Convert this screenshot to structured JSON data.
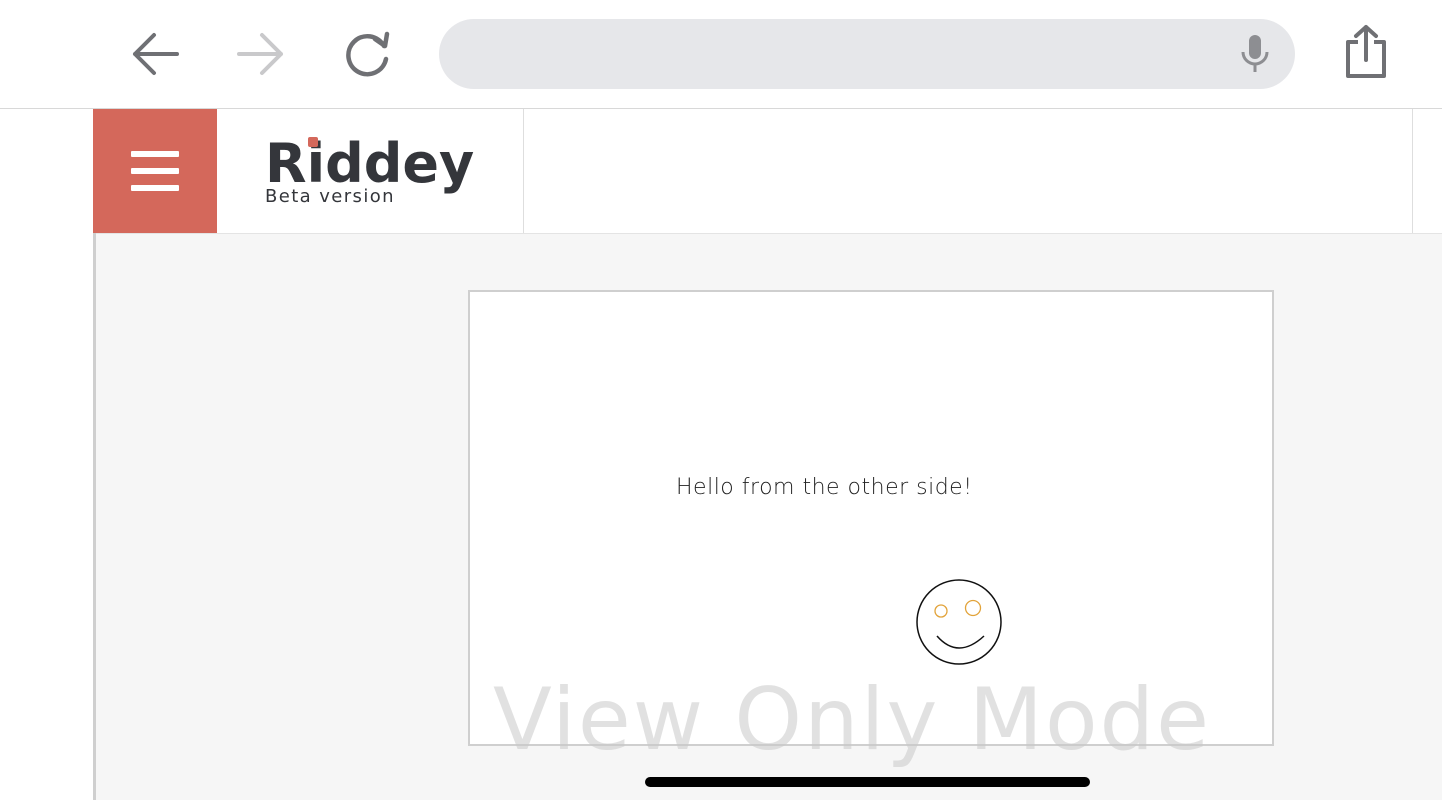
{
  "browser": {
    "address_value": "",
    "icons": {
      "back": "arrow-left-icon",
      "forward": "arrow-right-icon",
      "reload": "reload-icon",
      "mic": "microphone-icon",
      "share": "share-icon"
    }
  },
  "app": {
    "logo_name": "Riddey",
    "logo_subtitle": "Beta version",
    "menu_icon": "hamburger-menu-icon",
    "accent_color": "#d4685b"
  },
  "canvas": {
    "text": "Hello from the other side!",
    "drawing": "smiley-face-drawing"
  },
  "watermark": "View Only Mode"
}
